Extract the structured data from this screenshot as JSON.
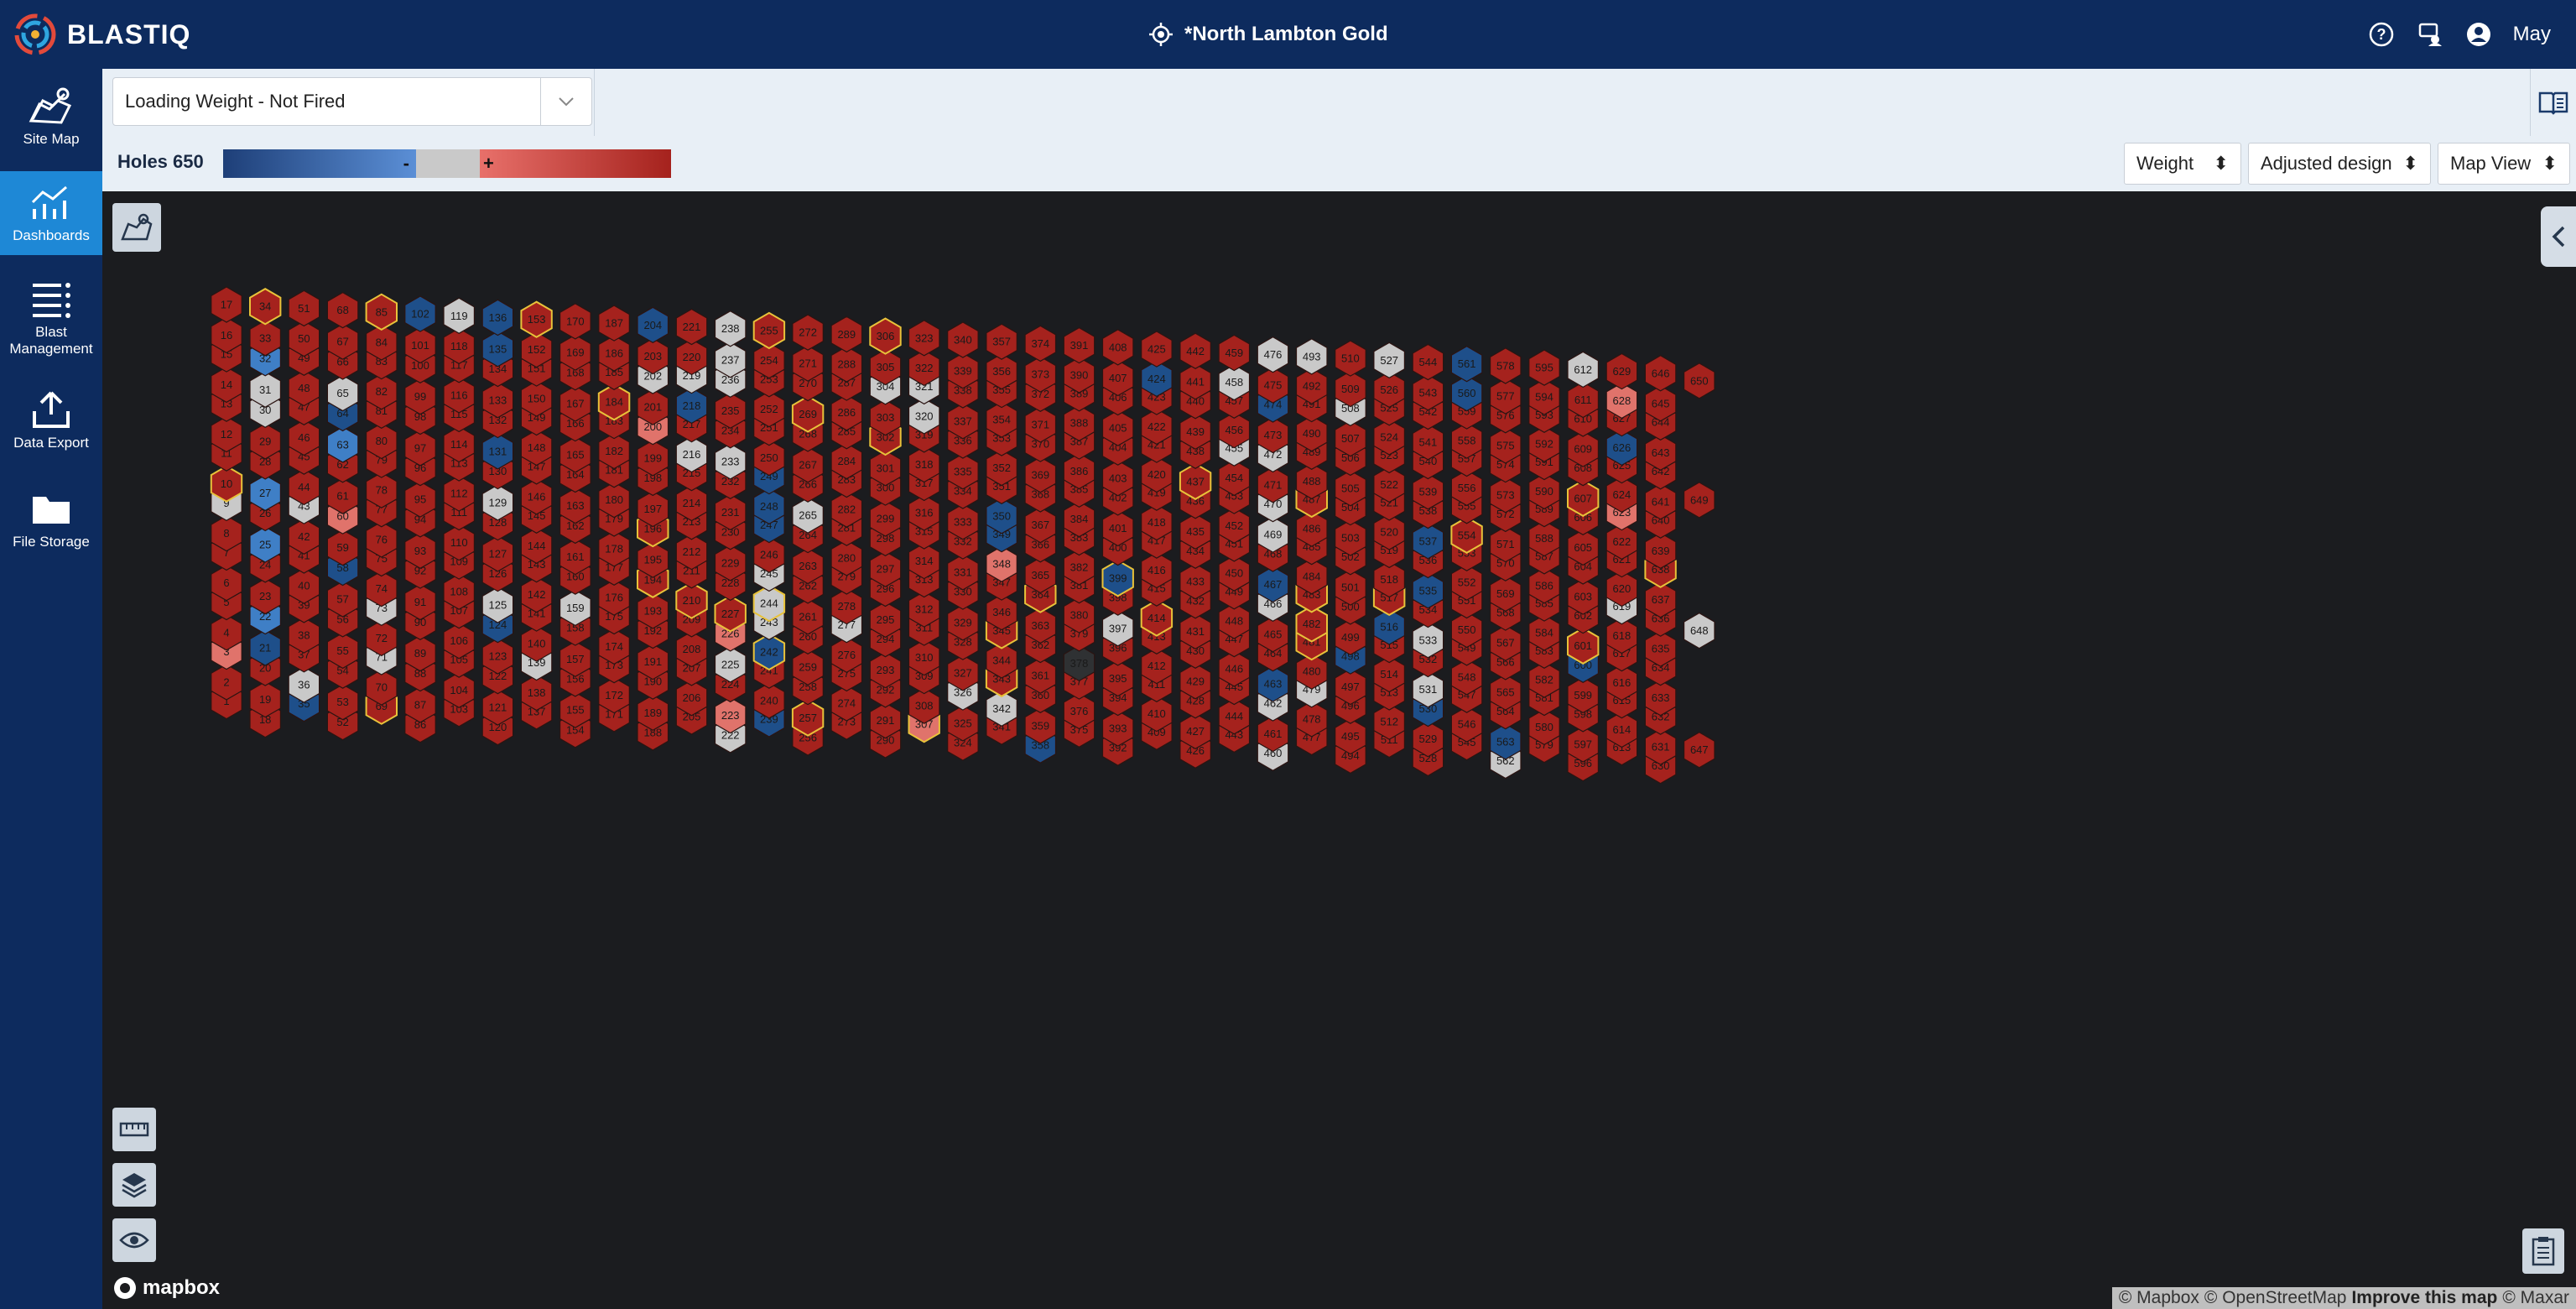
{
  "app": {
    "name": "BLASTIQ"
  },
  "header": {
    "site_name": "*North Lambton Gold",
    "user_name": "May"
  },
  "sidebar": {
    "items": [
      {
        "label": "Site Map",
        "icon": "site-map-icon"
      },
      {
        "label": "Dashboards",
        "icon": "dashboard-icon",
        "active": true
      },
      {
        "label": "Blast Management",
        "icon": "blast-management-icon"
      },
      {
        "label": "Data Export",
        "icon": "export-icon"
      },
      {
        "label": "File Storage",
        "icon": "folder-icon"
      }
    ]
  },
  "toolbar": {
    "mode_select": "Loading Weight - Not Fired"
  },
  "legend_bar": {
    "holes_label": "Holes 650",
    "neg_sign": "-",
    "pos_sign": "+",
    "colors": {
      "neg": "#1e3f78",
      "neutral": "#c9c9c9",
      "pos": "#a5221d"
    }
  },
  "dropdowns": {
    "metric": "Weight",
    "design": "Adjusted design",
    "view": "Map View"
  },
  "map": {
    "hole_count": 650,
    "colors": {
      "over": "#a5221d",
      "slightly_over": "#e0736b",
      "under": "#1e4f8a",
      "slightly_under": "#3f7fc6",
      "on_target": "#c9c9c9",
      "no_data": "#2f3133",
      "outline_highlight": "#e8c23a"
    },
    "neutral_holes": [
      9,
      31,
      30,
      36,
      43,
      65,
      71,
      73,
      119,
      125,
      129,
      139,
      159,
      202,
      216,
      219,
      222,
      225,
      233,
      236,
      237,
      238,
      243,
      244,
      245,
      265,
      277,
      304,
      320,
      321,
      326,
      342,
      397,
      455,
      458,
      460,
      462,
      466,
      469,
      470,
      472,
      476,
      479,
      493,
      508,
      527,
      531,
      533,
      562,
      612,
      619,
      648
    ],
    "under_holes": [
      21,
      35,
      58,
      64,
      102,
      124,
      131,
      135,
      136,
      204,
      218,
      239,
      242,
      247,
      248,
      249,
      349,
      350,
      358,
      399,
      424,
      463,
      467,
      474,
      498,
      516,
      530,
      535,
      537,
      560,
      561,
      563,
      600,
      626
    ],
    "slightly_under_holes": [
      22,
      25,
      27,
      32,
      63
    ],
    "slightly_over_holes": [
      3,
      60,
      200,
      223,
      226,
      307,
      348,
      623,
      628
    ],
    "no_data_holes": [
      378
    ],
    "highlighted_holes": [
      10,
      34,
      69,
      85,
      153,
      184,
      194,
      196,
      210,
      227,
      242,
      244,
      255,
      257,
      269,
      302,
      306,
      307,
      343,
      345,
      364,
      399,
      414,
      437,
      481,
      482,
      483,
      487,
      517,
      554,
      601,
      607,
      638
    ]
  },
  "map_controls": {
    "mapbox_label": "mapbox"
  },
  "attribution": {
    "mapbox": "© Mapbox",
    "osm": "© OpenStreetMap",
    "improve": "Improve this map",
    "maxar": "© Maxar"
  }
}
